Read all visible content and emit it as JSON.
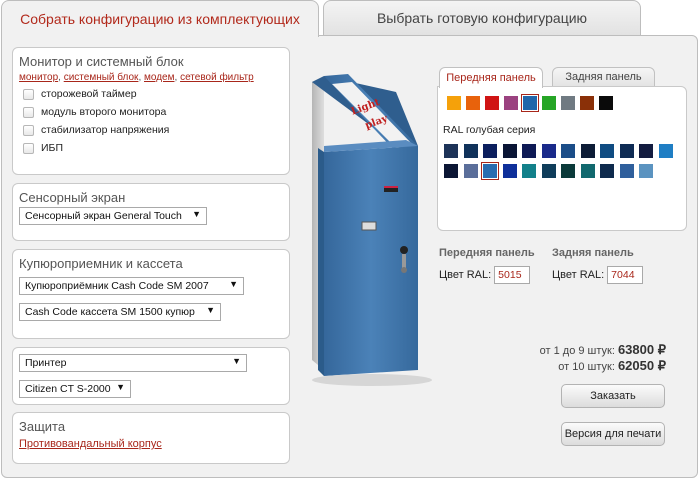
{
  "tabs": {
    "configure": "Собрать конфигурацию из комплектующих",
    "ready": "Выбрать готовую конфигурацию"
  },
  "monitor": {
    "title": "Монитор и системный блок",
    "links": [
      "монитор",
      "системный блок",
      "модем",
      "сетевой фильтр"
    ],
    "options": [
      "сторожевой таймер",
      "модуль второго монитора",
      "стабилизатор напряжения",
      "ИБП"
    ]
  },
  "touch": {
    "title": "Сенсорный экран",
    "select": "Сенсорный экран General Touch"
  },
  "bill": {
    "title": "Купюроприемник и кассета",
    "select1": "Купюроприёмник Cash Code SM 2007",
    "select2": "Cash Code кассета SM 1500 купюр"
  },
  "printer": {
    "select1": "Принтер",
    "select2": "Citizen CT S-2000"
  },
  "protection": {
    "title": "Защита",
    "link": "Противовандальный корпус"
  },
  "kiosk": {
    "logo_line1": "Light",
    "logo_line2": "play"
  },
  "color_tabs": {
    "front": "Передняя панель",
    "back": "Задняя панель"
  },
  "colors": {
    "row": [
      "#f5a10a",
      "#e8620c",
      "#d01414",
      "#9b4280",
      "#2266aa",
      "#26a526",
      "#707a82",
      "#8a3008",
      "#0a0a0a"
    ],
    "row_selected": 4,
    "series_label": "RAL голубая серия",
    "series": [
      "#1d3358",
      "#10325a",
      "#0c1f5e",
      "#0a1535",
      "#0e1a55",
      "#1a2a8a",
      "#1b4d88",
      "#0d1c36",
      "#0f4c82",
      "#0e2b54",
      "#131c40",
      "#1f7ec4",
      "#0b1634",
      "#5a6e9a",
      "#2a6cb0",
      "#0e2f9a",
      "#12808a",
      "#0f3d5a",
      "#0b3a3a",
      "#11686e",
      "#0e2a4d",
      "#2f5f9c",
      "#5b93c0"
    ],
    "series_selected": 14
  },
  "front_panel": {
    "heading": "Передняя панель",
    "label": "Цвет RAL:",
    "value": "5015"
  },
  "back_panel": {
    "heading": "Задняя панель",
    "label": "Цвет RAL:",
    "value": "7044"
  },
  "prices": {
    "p1_text": "от 1 до 9 штук:",
    "p1_value": "63800 ₽",
    "p2_text": "от 10 штук:",
    "p2_value": "62050 ₽"
  },
  "buttons": {
    "order": "Заказать",
    "print": "Версия для печати"
  },
  "palette": {
    "accent": "#a8261a",
    "kiosk_blue": "#3e74a8"
  }
}
